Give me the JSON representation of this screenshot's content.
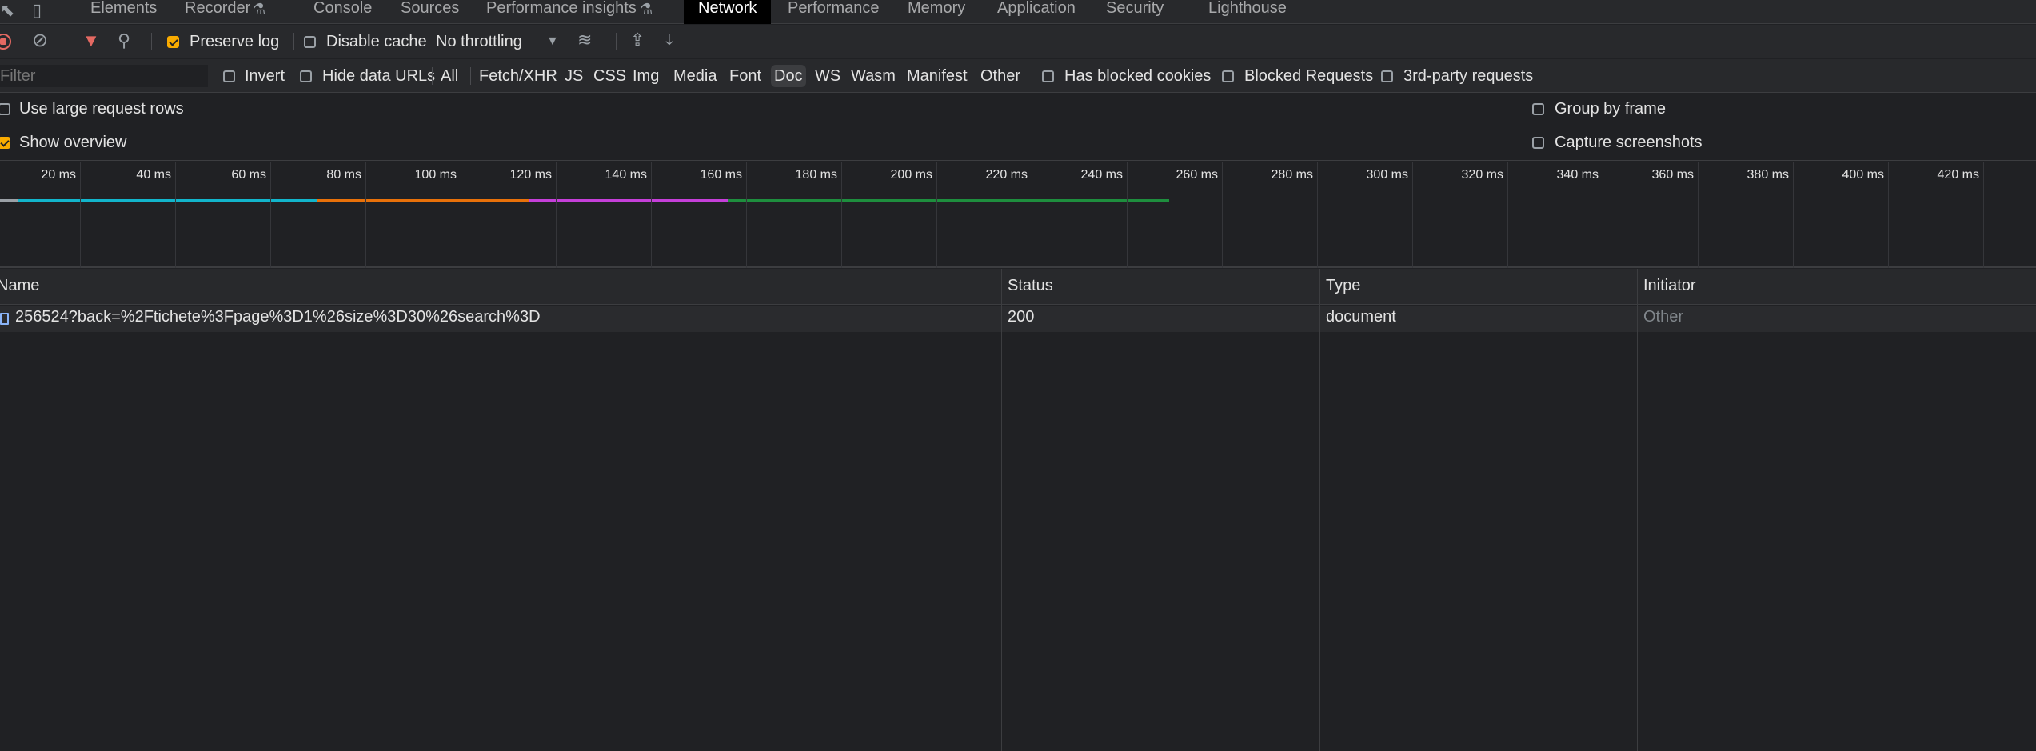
{
  "tabs": [
    {
      "label": "Elements"
    },
    {
      "label": "Recorder"
    },
    {
      "label": "Console"
    },
    {
      "label": "Sources"
    },
    {
      "label": "Performance insights"
    },
    {
      "label": "Network"
    },
    {
      "label": "Performance"
    },
    {
      "label": "Memory"
    },
    {
      "label": "Application"
    },
    {
      "label": "Security"
    },
    {
      "label": "Lighthouse"
    }
  ],
  "toolbar": {
    "preserve_log": "Preserve log",
    "disable_cache": "Disable cache",
    "throttling": "No throttling"
  },
  "filter": {
    "placeholder": "Filter",
    "invert": "Invert",
    "hide_data_urls": "Hide data URLs",
    "types": [
      "All",
      "Fetch/XHR",
      "JS",
      "CSS",
      "Img",
      "Media",
      "Font",
      "Doc",
      "WS",
      "Wasm",
      "Manifest",
      "Other"
    ],
    "active_type": "Doc",
    "has_blocked_cookies": "Has blocked cookies",
    "blocked_requests": "Blocked Requests",
    "third_party": "3rd-party requests"
  },
  "options": {
    "large_rows": "Use large request rows",
    "show_overview": "Show overview",
    "group_by_frame": "Group by frame",
    "capture_screenshots": "Capture screenshots"
  },
  "overview": {
    "ticks": [
      "20 ms",
      "40 ms",
      "60 ms",
      "80 ms",
      "100 ms",
      "120 ms",
      "140 ms",
      "160 ms",
      "180 ms",
      "200 ms",
      "220 ms",
      "240 ms",
      "260 ms",
      "280 ms",
      "300 ms",
      "320 ms",
      "340 ms",
      "360 ms",
      "380 ms",
      "400 ms",
      "420 ms"
    ]
  },
  "table": {
    "headers": {
      "name": "Name",
      "status": "Status",
      "type": "Type",
      "initiator": "Initiator"
    },
    "rows": [
      {
        "name": "256524?back=%2Ftichete%3Fpage%3D1%26size%3D30%26search%3D",
        "status": "200",
        "type": "document",
        "initiator": "Other"
      }
    ]
  },
  "colors": {
    "accent": "#f9ab00",
    "teal": "#12b5cb",
    "orange": "#e8710a",
    "purple": "#c53fd9",
    "green": "#1e8e3e"
  }
}
